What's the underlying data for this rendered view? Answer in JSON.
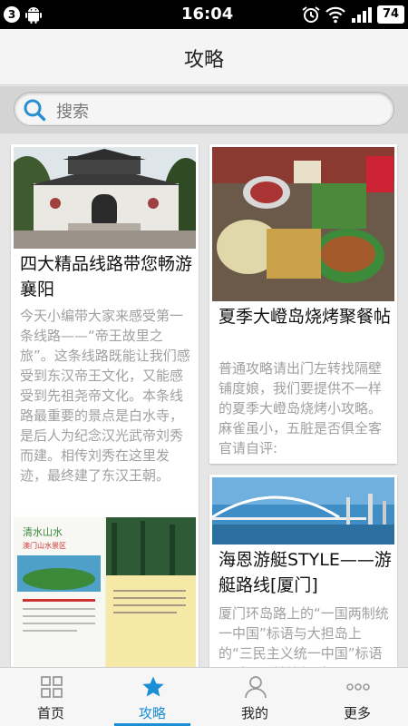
{
  "status_bar": {
    "notification_count": "3",
    "time": "16:04",
    "battery": "74"
  },
  "header": {
    "title": "攻略"
  },
  "search": {
    "placeholder": "搜索"
  },
  "cards": [
    {
      "title": "四大精品线路带您畅游襄阳",
      "description": "今天小编带大家来感受第一条线路——“帝王故里之旅”。这条线路既能让我们感受到东汉帝王文化，又能感受到先祖尧帝文化。本条线路最重要的景点是白水寺，是后人为纪念汉光武帝刘秀而建。相传刘秀在这里发迹，最终建了东汉王朝。"
    },
    {
      "title": "夏季大嶝岛烧烤聚餐帖",
      "description": "普通攻略请出门左转找隔壁铺度娘，我们要提供不一样的夏季大嶝岛烧烤小攻略。麻雀虽小，五脏是否俱全客官请自评:"
    },
    {
      "title": "海恩游艇STYLE——游艇路线[厦门]",
      "description": "厦门环岛路上的“一国两制统一中国”标语与大担岛上的“三民主义统一中国”标语面对面，针锋相对"
    },
    {
      "title": "",
      "description": "",
      "image_text": {
        "logo": "清水山水",
        "heading": "澳门山水景区"
      }
    }
  ],
  "tabs": [
    {
      "label": "首页",
      "icon": "grid-icon"
    },
    {
      "label": "攻略",
      "icon": "star-icon",
      "active": true
    },
    {
      "label": "我的",
      "icon": "person-icon"
    },
    {
      "label": "更多",
      "icon": "more-icon"
    }
  ],
  "colors": {
    "accent": "#1b8fd6",
    "desc_text": "#a0a0a0"
  }
}
